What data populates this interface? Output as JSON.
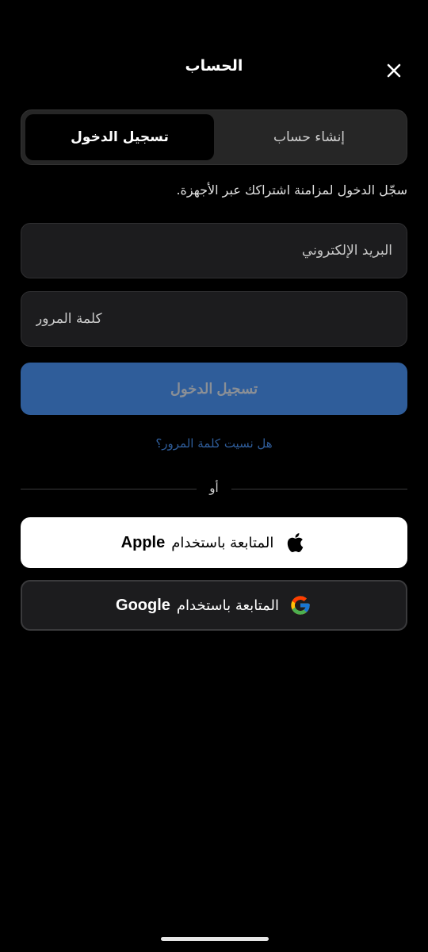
{
  "header": {
    "title": "الحساب"
  },
  "tabs": {
    "login_label": "تسجيل الدخول",
    "signup_label": "إنشاء حساب"
  },
  "subtitle": "سجّل الدخول لمزامنة اشتراكك عبر الأجهزة.",
  "form": {
    "email_placeholder": "البريد الإلكتروني",
    "password_placeholder": "كلمة المرور",
    "submit_label": "تسجيل الدخول",
    "forgot_label": "هل نسيت كلمة المرور؟"
  },
  "divider": {
    "or_label": "أو"
  },
  "social": {
    "apple": {
      "prefix": "المتابعة باستخدام",
      "brand": "Apple"
    },
    "google": {
      "prefix": "المتابعة باستخدام",
      "brand": "Google"
    }
  },
  "colors": {
    "background": "#000000",
    "primary_button": "#2f5d9a",
    "link": "#2f5d9a",
    "field_bg": "#1c1c1e"
  },
  "icons": {
    "close": "close-icon",
    "apple": "apple-logo-icon",
    "google": "google-logo-icon"
  }
}
